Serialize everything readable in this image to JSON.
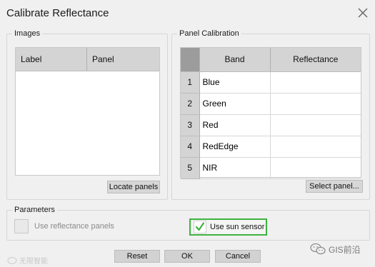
{
  "dialog": {
    "title": "Calibrate Reflectance"
  },
  "images": {
    "group_label": "Images",
    "columns": [
      "Label",
      "Panel"
    ],
    "rows": [],
    "locate_button": "Locate panels"
  },
  "panel_calibration": {
    "group_label": "Panel Calibration",
    "columns": [
      "Band",
      "Reflectance"
    ],
    "rows": [
      {
        "index": "1",
        "band": "Blue",
        "reflectance": ""
      },
      {
        "index": "2",
        "band": "Green",
        "reflectance": ""
      },
      {
        "index": "3",
        "band": "Red",
        "reflectance": ""
      },
      {
        "index": "4",
        "band": "RedEdge",
        "reflectance": ""
      },
      {
        "index": "5",
        "band": "NIR",
        "reflectance": ""
      }
    ],
    "select_button": "Select panel..."
  },
  "parameters": {
    "group_label": "Parameters",
    "use_reflectance_panels": {
      "label": "Use reflectance panels",
      "checked": false,
      "enabled": false
    },
    "use_sun_sensor": {
      "label": "Use sun sensor",
      "checked": true,
      "enabled": true
    },
    "highlight_color": "#3eb33e"
  },
  "footer": {
    "reset": "Reset",
    "ok": "OK",
    "cancel": "Cancel"
  },
  "watermarks": {
    "left": "无限智能",
    "right": "GIS前沿"
  }
}
